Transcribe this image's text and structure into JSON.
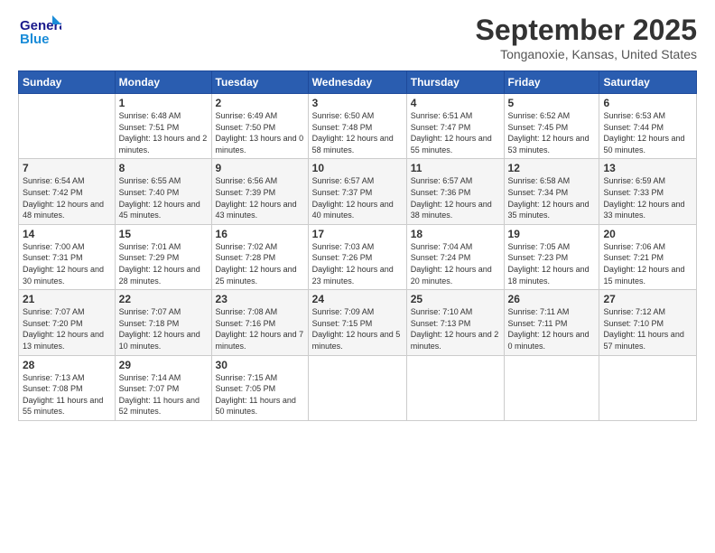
{
  "logo": {
    "line1": "General",
    "line2": "Blue"
  },
  "title": "September 2025",
  "location": "Tonganoxie, Kansas, United States",
  "days_header": [
    "Sunday",
    "Monday",
    "Tuesday",
    "Wednesday",
    "Thursday",
    "Friday",
    "Saturday"
  ],
  "weeks": [
    [
      {
        "num": "",
        "sunrise": "",
        "sunset": "",
        "daylight": ""
      },
      {
        "num": "1",
        "sunrise": "Sunrise: 6:48 AM",
        "sunset": "Sunset: 7:51 PM",
        "daylight": "Daylight: 13 hours and 2 minutes."
      },
      {
        "num": "2",
        "sunrise": "Sunrise: 6:49 AM",
        "sunset": "Sunset: 7:50 PM",
        "daylight": "Daylight: 13 hours and 0 minutes."
      },
      {
        "num": "3",
        "sunrise": "Sunrise: 6:50 AM",
        "sunset": "Sunset: 7:48 PM",
        "daylight": "Daylight: 12 hours and 58 minutes."
      },
      {
        "num": "4",
        "sunrise": "Sunrise: 6:51 AM",
        "sunset": "Sunset: 7:47 PM",
        "daylight": "Daylight: 12 hours and 55 minutes."
      },
      {
        "num": "5",
        "sunrise": "Sunrise: 6:52 AM",
        "sunset": "Sunset: 7:45 PM",
        "daylight": "Daylight: 12 hours and 53 minutes."
      },
      {
        "num": "6",
        "sunrise": "Sunrise: 6:53 AM",
        "sunset": "Sunset: 7:44 PM",
        "daylight": "Daylight: 12 hours and 50 minutes."
      }
    ],
    [
      {
        "num": "7",
        "sunrise": "Sunrise: 6:54 AM",
        "sunset": "Sunset: 7:42 PM",
        "daylight": "Daylight: 12 hours and 48 minutes."
      },
      {
        "num": "8",
        "sunrise": "Sunrise: 6:55 AM",
        "sunset": "Sunset: 7:40 PM",
        "daylight": "Daylight: 12 hours and 45 minutes."
      },
      {
        "num": "9",
        "sunrise": "Sunrise: 6:56 AM",
        "sunset": "Sunset: 7:39 PM",
        "daylight": "Daylight: 12 hours and 43 minutes."
      },
      {
        "num": "10",
        "sunrise": "Sunrise: 6:57 AM",
        "sunset": "Sunset: 7:37 PM",
        "daylight": "Daylight: 12 hours and 40 minutes."
      },
      {
        "num": "11",
        "sunrise": "Sunrise: 6:57 AM",
        "sunset": "Sunset: 7:36 PM",
        "daylight": "Daylight: 12 hours and 38 minutes."
      },
      {
        "num": "12",
        "sunrise": "Sunrise: 6:58 AM",
        "sunset": "Sunset: 7:34 PM",
        "daylight": "Daylight: 12 hours and 35 minutes."
      },
      {
        "num": "13",
        "sunrise": "Sunrise: 6:59 AM",
        "sunset": "Sunset: 7:33 PM",
        "daylight": "Daylight: 12 hours and 33 minutes."
      }
    ],
    [
      {
        "num": "14",
        "sunrise": "Sunrise: 7:00 AM",
        "sunset": "Sunset: 7:31 PM",
        "daylight": "Daylight: 12 hours and 30 minutes."
      },
      {
        "num": "15",
        "sunrise": "Sunrise: 7:01 AM",
        "sunset": "Sunset: 7:29 PM",
        "daylight": "Daylight: 12 hours and 28 minutes."
      },
      {
        "num": "16",
        "sunrise": "Sunrise: 7:02 AM",
        "sunset": "Sunset: 7:28 PM",
        "daylight": "Daylight: 12 hours and 25 minutes."
      },
      {
        "num": "17",
        "sunrise": "Sunrise: 7:03 AM",
        "sunset": "Sunset: 7:26 PM",
        "daylight": "Daylight: 12 hours and 23 minutes."
      },
      {
        "num": "18",
        "sunrise": "Sunrise: 7:04 AM",
        "sunset": "Sunset: 7:24 PM",
        "daylight": "Daylight: 12 hours and 20 minutes."
      },
      {
        "num": "19",
        "sunrise": "Sunrise: 7:05 AM",
        "sunset": "Sunset: 7:23 PM",
        "daylight": "Daylight: 12 hours and 18 minutes."
      },
      {
        "num": "20",
        "sunrise": "Sunrise: 7:06 AM",
        "sunset": "Sunset: 7:21 PM",
        "daylight": "Daylight: 12 hours and 15 minutes."
      }
    ],
    [
      {
        "num": "21",
        "sunrise": "Sunrise: 7:07 AM",
        "sunset": "Sunset: 7:20 PM",
        "daylight": "Daylight: 12 hours and 13 minutes."
      },
      {
        "num": "22",
        "sunrise": "Sunrise: 7:07 AM",
        "sunset": "Sunset: 7:18 PM",
        "daylight": "Daylight: 12 hours and 10 minutes."
      },
      {
        "num": "23",
        "sunrise": "Sunrise: 7:08 AM",
        "sunset": "Sunset: 7:16 PM",
        "daylight": "Daylight: 12 hours and 7 minutes."
      },
      {
        "num": "24",
        "sunrise": "Sunrise: 7:09 AM",
        "sunset": "Sunset: 7:15 PM",
        "daylight": "Daylight: 12 hours and 5 minutes."
      },
      {
        "num": "25",
        "sunrise": "Sunrise: 7:10 AM",
        "sunset": "Sunset: 7:13 PM",
        "daylight": "Daylight: 12 hours and 2 minutes."
      },
      {
        "num": "26",
        "sunrise": "Sunrise: 7:11 AM",
        "sunset": "Sunset: 7:11 PM",
        "daylight": "Daylight: 12 hours and 0 minutes."
      },
      {
        "num": "27",
        "sunrise": "Sunrise: 7:12 AM",
        "sunset": "Sunset: 7:10 PM",
        "daylight": "Daylight: 11 hours and 57 minutes."
      }
    ],
    [
      {
        "num": "28",
        "sunrise": "Sunrise: 7:13 AM",
        "sunset": "Sunset: 7:08 PM",
        "daylight": "Daylight: 11 hours and 55 minutes."
      },
      {
        "num": "29",
        "sunrise": "Sunrise: 7:14 AM",
        "sunset": "Sunset: 7:07 PM",
        "daylight": "Daylight: 11 hours and 52 minutes."
      },
      {
        "num": "30",
        "sunrise": "Sunrise: 7:15 AM",
        "sunset": "Sunset: 7:05 PM",
        "daylight": "Daylight: 11 hours and 50 minutes."
      },
      {
        "num": "",
        "sunrise": "",
        "sunset": "",
        "daylight": ""
      },
      {
        "num": "",
        "sunrise": "",
        "sunset": "",
        "daylight": ""
      },
      {
        "num": "",
        "sunrise": "",
        "sunset": "",
        "daylight": ""
      },
      {
        "num": "",
        "sunrise": "",
        "sunset": "",
        "daylight": ""
      }
    ]
  ]
}
